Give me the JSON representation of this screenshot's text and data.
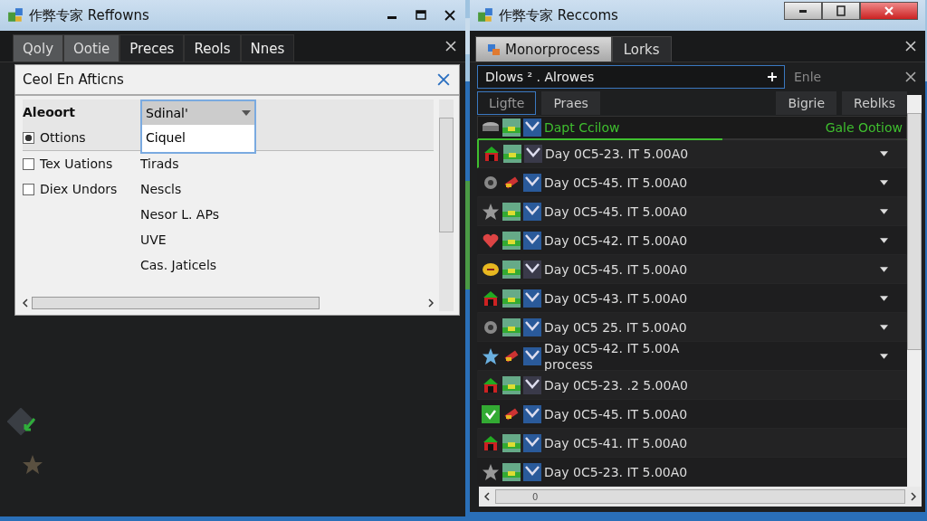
{
  "left_window": {
    "title": "作弊专家 Reffowns",
    "tabs": [
      {
        "label": "Qoly",
        "selected": true
      },
      {
        "label": "Ootie",
        "selected": true
      },
      {
        "label": "Preces",
        "selected": false
      },
      {
        "label": "Reols",
        "selected": false
      },
      {
        "label": "Nnes",
        "selected": false
      }
    ],
    "panel": {
      "title": "Ceol En Afticns",
      "header": {
        "label": "Aleoort",
        "dropdown_value": "Sdinal'",
        "dropdown_option": "Ciquel"
      },
      "option": {
        "label": "Ottions",
        "checked": true
      },
      "rows": [
        {
          "label": "Tex Uations",
          "checked": false,
          "value": "Tirads"
        },
        {
          "label": "Diex Undors",
          "checked": false,
          "value": "Nescls"
        },
        {
          "value": "Nesor L. APs"
        },
        {
          "value": "UVE"
        },
        {
          "value": "Cas. Jaticels"
        }
      ]
    }
  },
  "right_window": {
    "title": "作弊专家 Reccoms",
    "tabs": [
      {
        "label": "Monorprocess",
        "selected": true
      },
      {
        "label": "Lorks",
        "selected": false
      }
    ],
    "search": {
      "value": "Dlows ² . Alrowes",
      "placeholder": "Enle"
    },
    "buttons": [
      {
        "label": "Ligfte",
        "selected": true
      },
      {
        "label": "Praes",
        "selected": false
      },
      {
        "label": "Bigrie",
        "selected": false
      },
      {
        "label": "Reblks",
        "selected": false
      }
    ],
    "header": {
      "left": "Dapt Ccilow",
      "right": "Gale Ootiow",
      "level": 0.57
    },
    "rows": [
      {
        "text": "Day 0C5-23. IT 5.00A0",
        "selected": true,
        "expandable": true
      },
      {
        "text": "Day 0C5-45. IT 5.00A0",
        "selected": false,
        "expandable": true
      },
      {
        "text": "Day 0C5-45. IT 5.00A0",
        "selected": false,
        "expandable": true
      },
      {
        "text": "Day 0C5-42. IT 5.00A0",
        "selected": false,
        "expandable": true
      },
      {
        "text": "Day 0C5-45. IT 5.00A0",
        "selected": false,
        "expandable": true
      },
      {
        "text": "Day 0C5-43. IT 5.00A0",
        "selected": false,
        "expandable": true
      },
      {
        "text": "Day 0C5 25. IT 5.00A0",
        "selected": false,
        "expandable": true
      },
      {
        "text": "Day 0C5-42. IT 5.00A",
        "subtext": "process",
        "selected": false,
        "expandable": true
      },
      {
        "text": "Day 0C5-23. .2 5.00A0",
        "selected": false,
        "expandable": false
      },
      {
        "text": "Day 0C5-45. IT 5.00A0",
        "selected": false,
        "expandable": false
      },
      {
        "text": "Day 0C5-41. IT 5.00A0",
        "selected": false,
        "expandable": false
      },
      {
        "text": "Day 0C5-23. IT 5.00A0",
        "selected": false,
        "expandable": false
      }
    ],
    "scrollbar_label": "0"
  }
}
